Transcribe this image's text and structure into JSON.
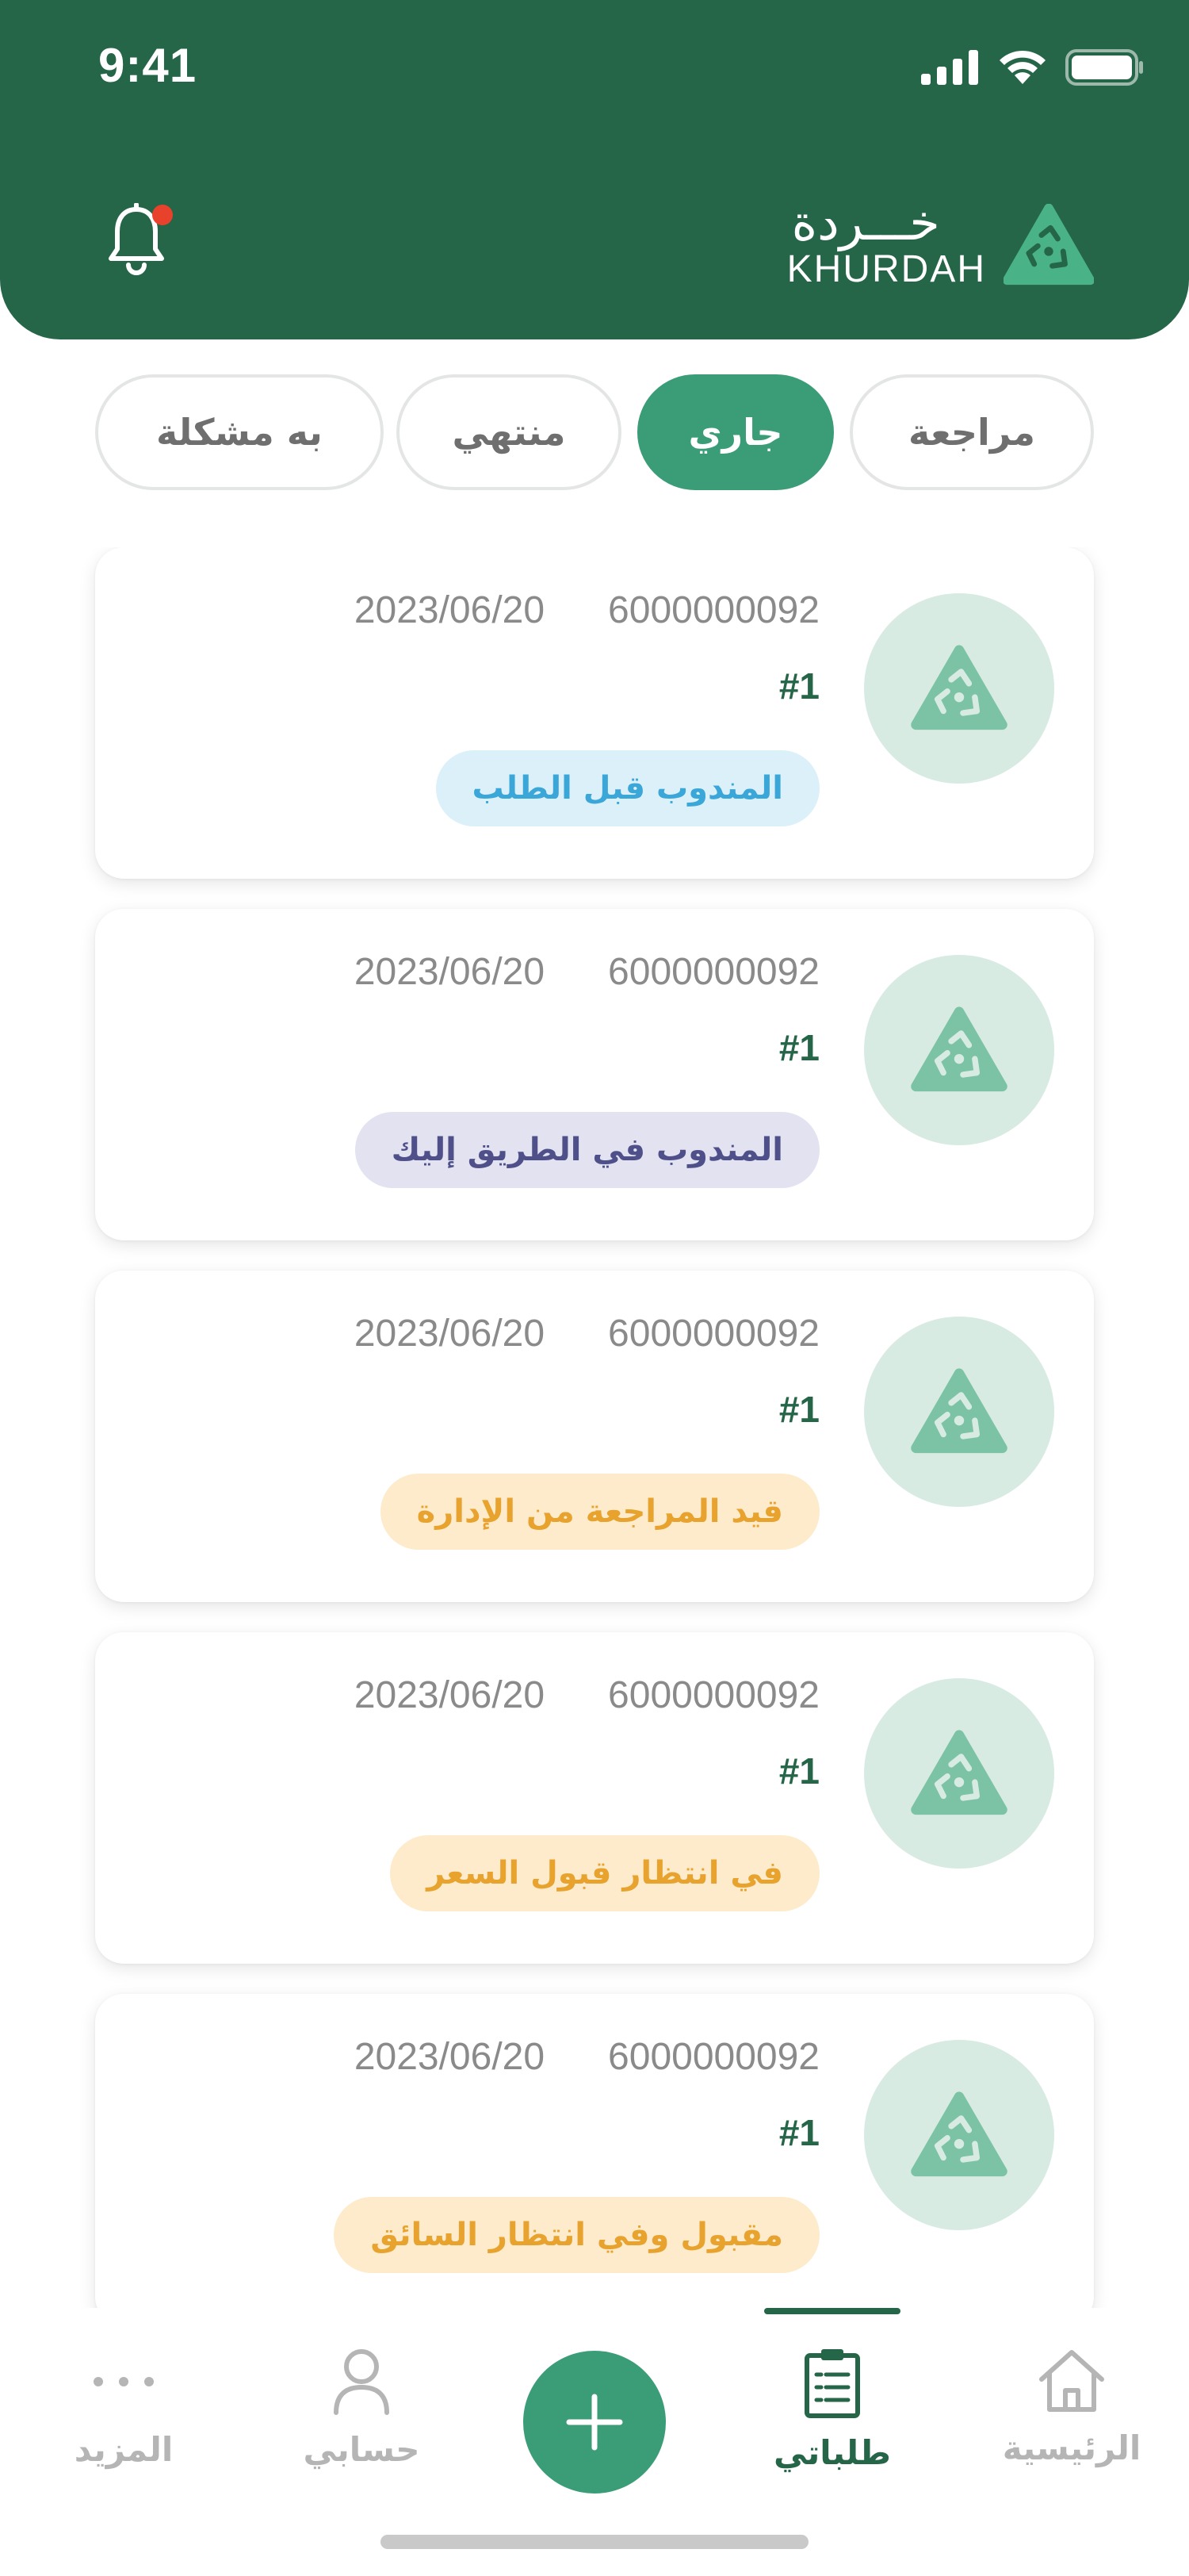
{
  "status_bar": {
    "time": "9:41"
  },
  "header": {
    "logo_arabic": "خـــردة",
    "logo_english": "KHURDAH",
    "notification_dot": true
  },
  "filters": {
    "items": [
      {
        "label": "مراجعة",
        "active": false
      },
      {
        "label": "جاري",
        "active": true
      },
      {
        "label": "منتهي",
        "active": false
      },
      {
        "label": "به مشكلة",
        "active": false
      }
    ]
  },
  "orders": [
    {
      "id": "6000000092",
      "date": "2023/06/20",
      "number": "#1",
      "status": "المندوب قبل الطلب",
      "status_bg": "#dcf0fa",
      "status_color": "#3aa7d8"
    },
    {
      "id": "6000000092",
      "date": "2023/06/20",
      "number": "#1",
      "status": "المندوب في الطريق إليك",
      "status_bg": "#e2e2f1",
      "status_color": "#4f4f8a"
    },
    {
      "id": "6000000092",
      "date": "2023/06/20",
      "number": "#1",
      "status": "قيد المراجعة من الإدارة",
      "status_bg": "#fdebcc",
      "status_color": "#e8a32e"
    },
    {
      "id": "6000000092",
      "date": "2023/06/20",
      "number": "#1",
      "status": "في انتظار قبول السعر",
      "status_bg": "#fdebcc",
      "status_color": "#e8a32e"
    },
    {
      "id": "6000000092",
      "date": "2023/06/20",
      "number": "#1",
      "status": "مقبول وفي انتظار السائق",
      "status_bg": "#fdebcc",
      "status_color": "#e8a32e"
    }
  ],
  "tabbar": {
    "home": "الرئيسية",
    "orders": "طلباتي",
    "account": "حسابي",
    "more": "المزيد",
    "active": "orders"
  },
  "colors": {
    "brand_dark": "#256548",
    "brand_accent": "#3a9d77",
    "icon_circle": "#d8ebe3",
    "icon_fill": "#7cc3a5"
  }
}
